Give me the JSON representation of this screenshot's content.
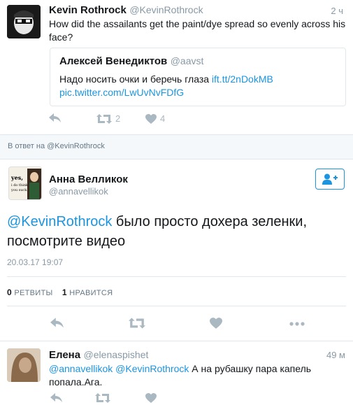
{
  "tweet1": {
    "author_name": "Kevin Rothrock",
    "author_handle": "@KevinRothrock",
    "time": "2 ч",
    "text": "How did the assailants get the paint/dye spread so evenly across his face?",
    "quote": {
      "author_name": "Алексей Венедиктов",
      "author_handle": "@aavst",
      "text": "Надо носить очки и беречь глаза",
      "link1": "ift.tt/2nDokMB",
      "link2": "pic.twitter.com/LwUvNvFDfG"
    },
    "retweets": "2",
    "likes": "4"
  },
  "reply_bar": "В ответ на @KevinRothrock",
  "main_tweet": {
    "author_name": "Анна Велликок",
    "author_handle": "@annavellikok",
    "avatar_text": "yes, i do think you suck.",
    "mention": "@KevinRothrock",
    "text": " было просто дохера зеленки, посмотрите видео",
    "date": "20.03.17 19:07",
    "retweets_count": "0",
    "retweets_label": "РЕТВИТЫ",
    "likes_count": "1",
    "likes_label": "НРАВИТСЯ"
  },
  "tweet3": {
    "author_name": "Елена",
    "author_handle": "@elenaspishet",
    "time": "49 м",
    "mention1": "@annavellikok",
    "mention2": "@KevinRothrock",
    "text": " А на рубашку пара капель попала.Ага."
  },
  "icons": {
    "reply": "reply-icon",
    "retweet": "retweet-icon",
    "like": "heart-icon",
    "more": "more-icon",
    "follow": "follow-user-icon"
  },
  "colors": {
    "link": "#1b95e0",
    "muted": "#8899a6",
    "border": "#e1e8ed"
  }
}
